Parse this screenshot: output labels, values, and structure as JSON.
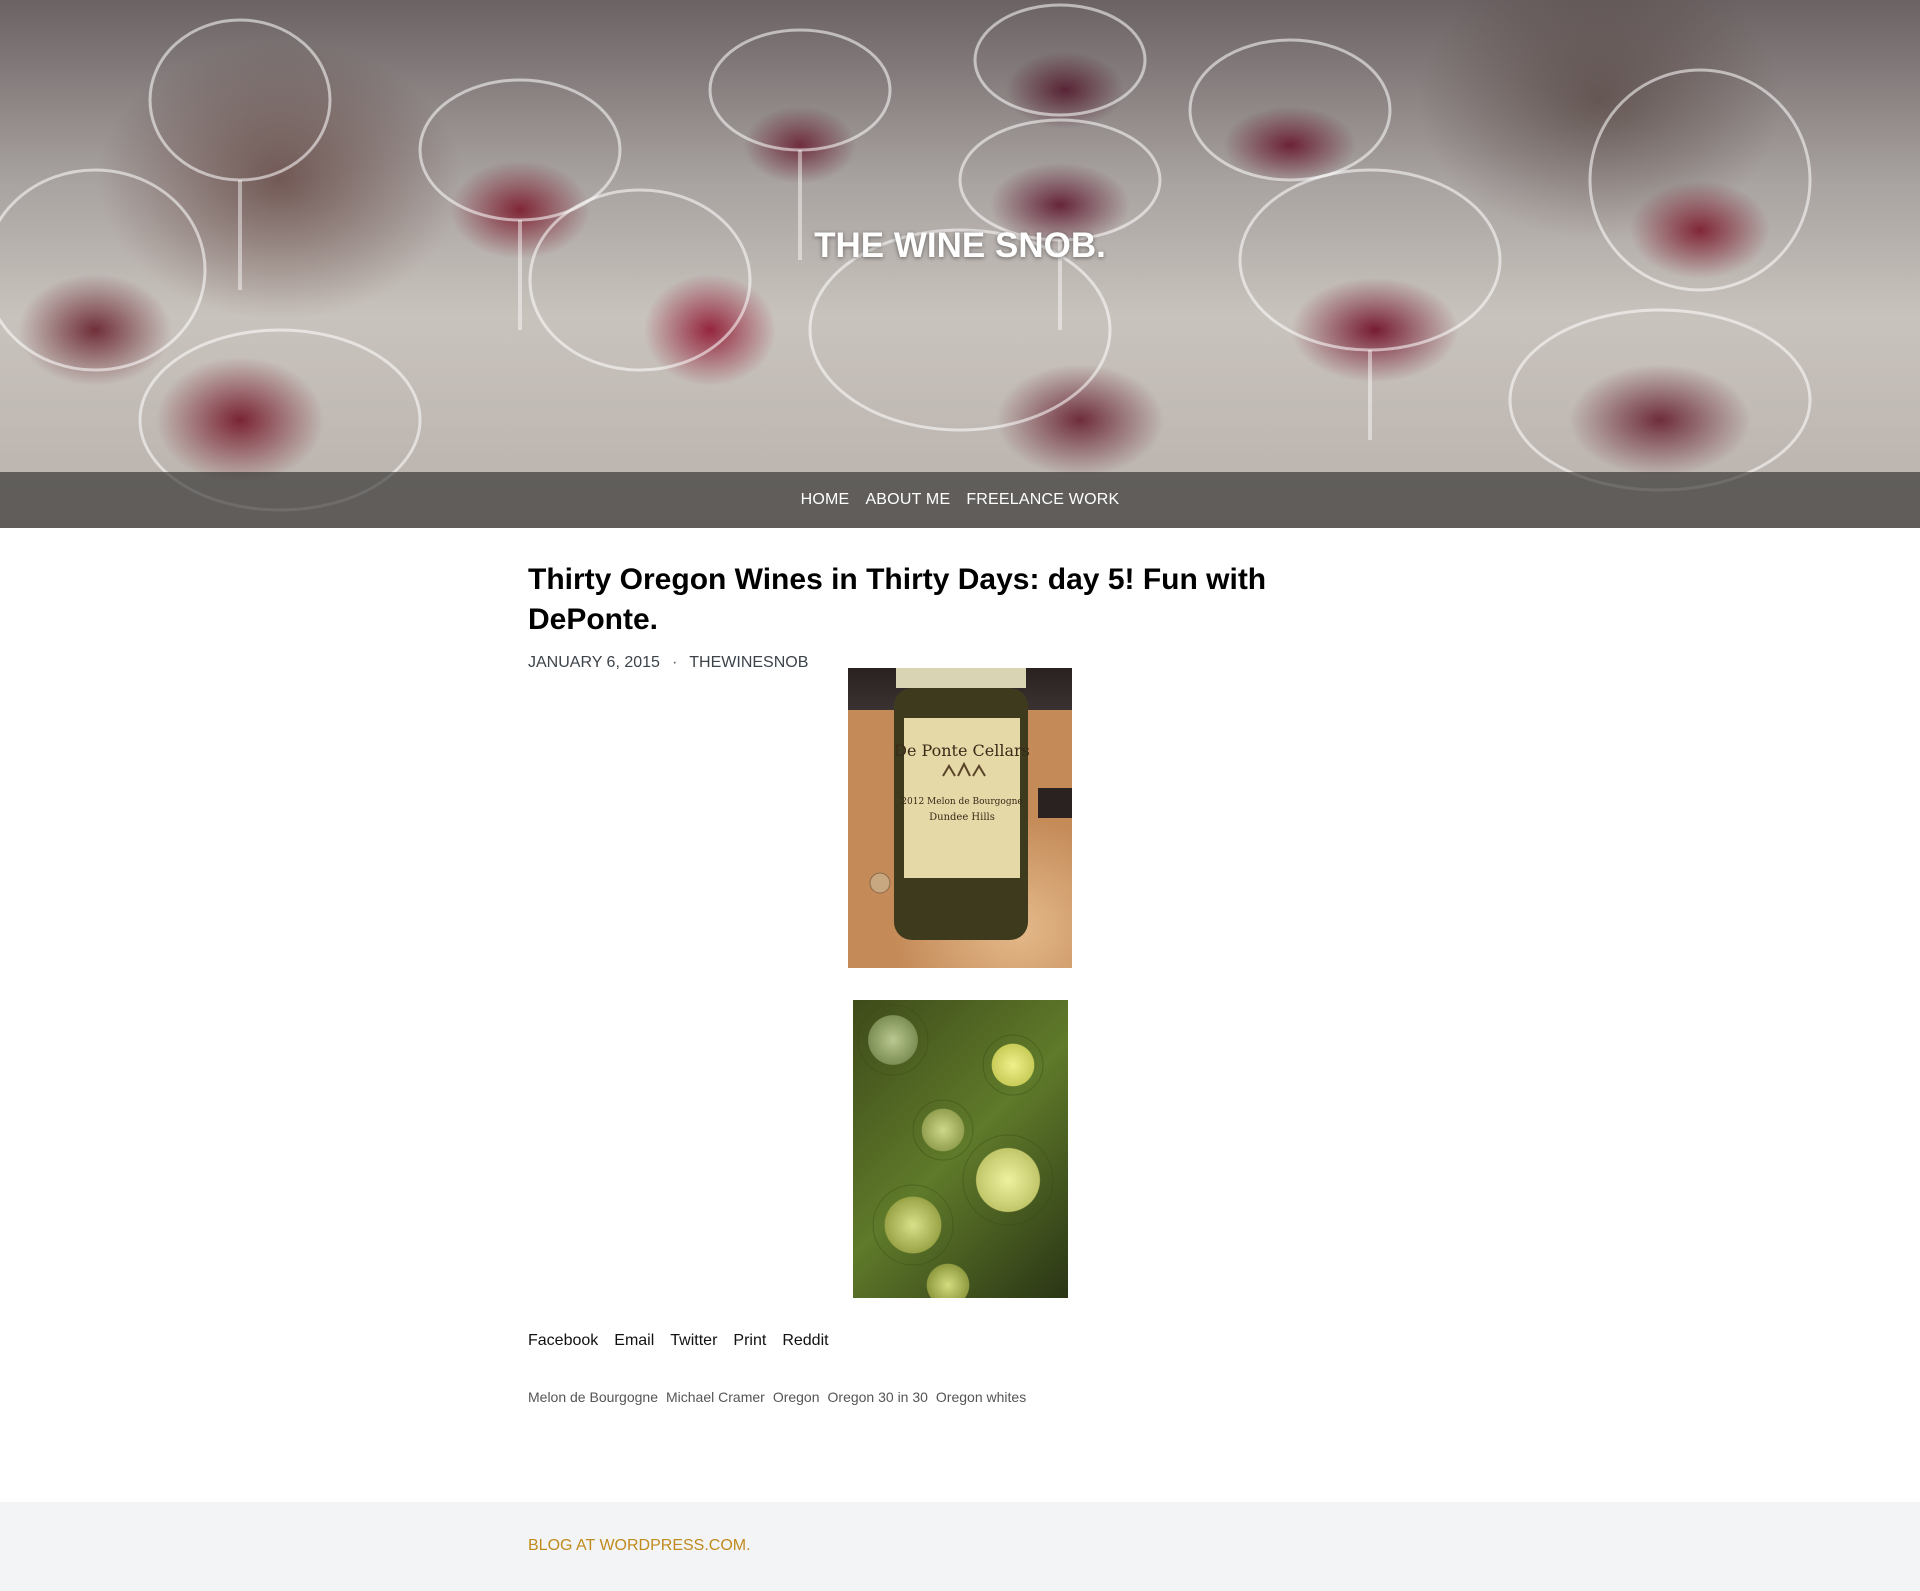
{
  "header": {
    "site_title": "THE WINE SNOB.",
    "nav": [
      "HOME",
      "ABOUT ME",
      "FREELANCE WORK"
    ]
  },
  "post": {
    "title": "Thirty Oregon Wines in Thirty Days: day 5! Fun with DePonte.",
    "date": "JANUARY 6, 2015",
    "separator": "·",
    "author": "THEWINESNOB",
    "bottle_label": {
      "line1": "De Ponte Cellars",
      "line2": "2012 Melon de Bourgogne",
      "line3": "Dundee Hills"
    }
  },
  "share": [
    "Facebook",
    "Email",
    "Twitter",
    "Print",
    "Reddit"
  ],
  "tags": [
    "Melon de Bourgogne",
    "Michael Cramer",
    "Oregon",
    "Oregon 30 in 30",
    "Oregon whites"
  ],
  "footer": {
    "link": "BLOG AT WORDPRESS.COM."
  },
  "colors": {
    "footer_link": "#c08a1e",
    "footer_bg": "#f3f4f5",
    "nav_bar": "rgba(40,40,40,0.62)"
  }
}
